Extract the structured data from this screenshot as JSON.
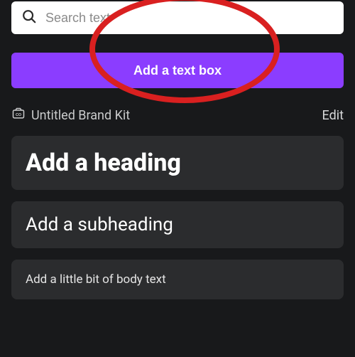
{
  "search": {
    "placeholder": "Search text"
  },
  "primary_button": {
    "label": "Add a text box"
  },
  "brand_kit": {
    "title": "Untitled Brand Kit",
    "edit_label": "Edit"
  },
  "default_styles": {
    "heading": "Add a heading",
    "subheading": "Add a subheading",
    "body": "Add a little bit of body text"
  },
  "colors": {
    "accent": "#8b3dff",
    "panel_bg": "#18191b",
    "annotation": "#d92020"
  }
}
